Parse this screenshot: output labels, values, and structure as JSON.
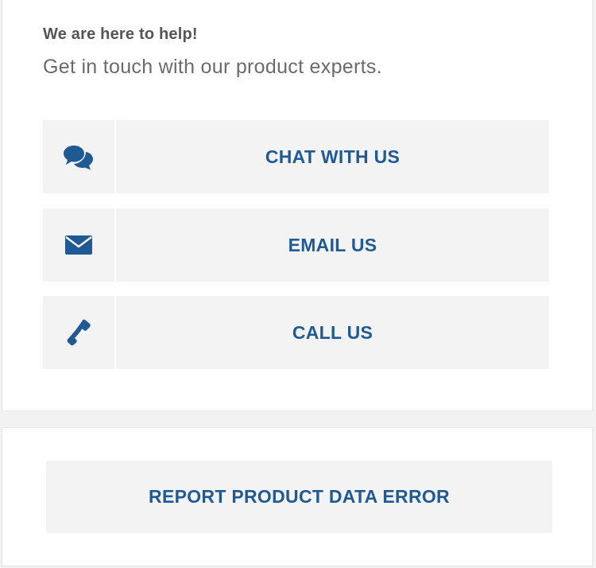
{
  "help": {
    "heading": "We are here to help!",
    "subtext": "Get in touch with our product experts."
  },
  "contact_options": [
    {
      "label": "CHAT WITH US",
      "icon": "chat-icon"
    },
    {
      "label": "EMAIL US",
      "icon": "envelope-icon"
    },
    {
      "label": "CALL US",
      "icon": "phone-icon"
    }
  ],
  "report": {
    "label": "REPORT PRODUCT DATA ERROR"
  },
  "colors": {
    "accent": "#1f5a94",
    "button_bg": "#f3f3f3",
    "heading_text": "#555555",
    "body_text": "#6b6b6b"
  }
}
